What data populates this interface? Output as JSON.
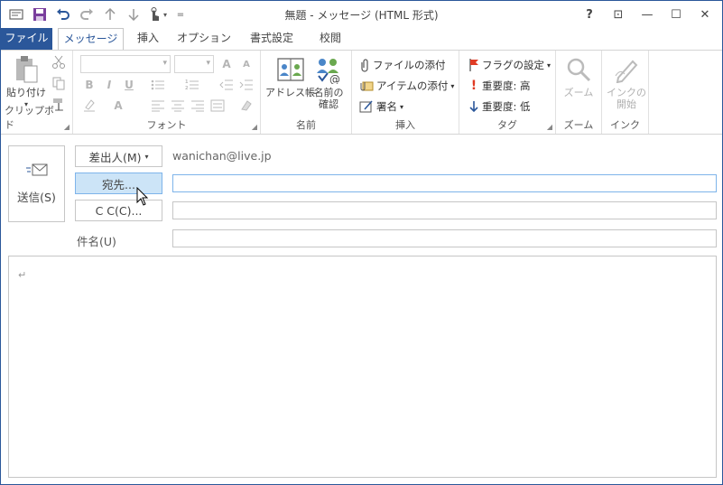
{
  "window": {
    "title": "無題 - メッセージ (HTML 形式)",
    "help": "?",
    "ribbon_opts": "⊡",
    "minimize": "—",
    "maximize": "☐",
    "close": "✕"
  },
  "qat": {
    "customize": "="
  },
  "tabs": [
    {
      "label": "ファイル"
    },
    {
      "label": "メッセージ"
    },
    {
      "label": "挿入"
    },
    {
      "label": "オプション"
    },
    {
      "label": "書式設定"
    },
    {
      "label": "校閲"
    }
  ],
  "ribbon": {
    "clipboard": {
      "label": "クリップボード",
      "paste": "貼り付け",
      "paste_arrow": "▾"
    },
    "font": {
      "label": "フォント",
      "bold": "B",
      "italic": "I",
      "underline": "U",
      "grow": "A",
      "shrink": "A",
      "fontcolor": "A"
    },
    "names": {
      "label": "名前",
      "address_book": "アドレス帳",
      "check_names_1": "名前の",
      "check_names_2": "確認"
    },
    "include": {
      "label": "挿入",
      "attach_file": "ファイルの添付",
      "attach_item": "アイテムの添付",
      "signature": "署名",
      "arrow": "▾"
    },
    "tags": {
      "label": "タグ",
      "follow_up": "フラグの設定",
      "high": "重要度: 高",
      "low": "重要度: 低",
      "arrow": "▾"
    },
    "zoom": {
      "label": "ズーム",
      "zoom": "ズーム"
    },
    "ink": {
      "label": "インク",
      "start_1": "インクの",
      "start_2": "開始"
    }
  },
  "compose": {
    "send": "送信(S)",
    "from_btn": "差出人(M)",
    "from_arrow": "▾",
    "from_value": "wanichan@live.jp",
    "to_btn": "宛先...",
    "cc_btn": "C C(C)...",
    "subject_label": "件名(U)",
    "to_value": "",
    "cc_value": "",
    "subject_value": "",
    "body_mark": "↵"
  },
  "colors": {
    "accent": "#2b579a",
    "highlight": "#cce4f7",
    "focus_border": "#7eb4ea"
  }
}
